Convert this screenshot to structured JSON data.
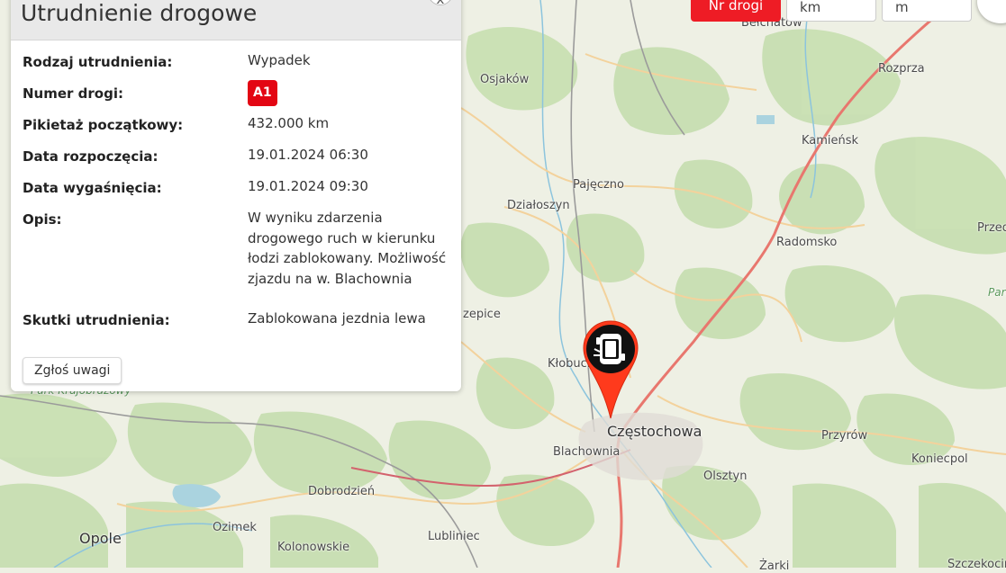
{
  "toolbar": {
    "road_number_label": "Nr drogi",
    "km_placeholder": "km",
    "m_placeholder": "m"
  },
  "popup": {
    "title": "Utrudnienie drogowe",
    "close_label": "x",
    "rows": [
      {
        "label": "Rodzaj utrudnienia:",
        "value": "Wypadek"
      },
      {
        "label": "Numer drogi:",
        "value": "A1"
      },
      {
        "label": "Pikietaż początkowy:",
        "value": "432.000 km"
      },
      {
        "label": "Data rozpoczęcia:",
        "value": "19.01.2024 06:30"
      },
      {
        "label": "Data wygaśnięcia:",
        "value": "19.01.2024 09:30"
      },
      {
        "label": "Opis:",
        "value": "W wyniku zdarzenia drogowego ruch w kierunku łodzi zablokowany. Możliwość zjazdu na w. Blachownia"
      },
      {
        "label": "Skutki utrudnienia:",
        "value": "Zablokowana jezdnia lewa"
      }
    ],
    "report_button": "Zgłoś uwagi"
  },
  "map": {
    "marker_icon": "accident-icon",
    "colors": {
      "marker": "#ff3a1c",
      "badge": "#e30613",
      "road_major": "#e8776e"
    },
    "places": [
      {
        "name": "Bełchatów"
      },
      {
        "name": "Rozprza"
      },
      {
        "name": "Osjaków"
      },
      {
        "name": "Kamieńsk"
      },
      {
        "name": "Pajęczno"
      },
      {
        "name": "Działoszyn"
      },
      {
        "name": "Radomsko"
      },
      {
        "name": "Przed"
      },
      {
        "name": "Park"
      },
      {
        "name": "zepice"
      },
      {
        "name": "Kłobuck"
      },
      {
        "name": "Częstochowa"
      },
      {
        "name": "Blachownia"
      },
      {
        "name": "Przyrów"
      },
      {
        "name": "Koniecpol"
      },
      {
        "name": "Olsztyn"
      },
      {
        "name": "Park Krajobrazowy"
      },
      {
        "name": "Dobrodzień"
      },
      {
        "name": "Ozimek"
      },
      {
        "name": "Opole"
      },
      {
        "name": "Kolonowskie"
      },
      {
        "name": "Lubliniec"
      },
      {
        "name": "Żarki"
      },
      {
        "name": "Szczekociny"
      }
    ]
  }
}
